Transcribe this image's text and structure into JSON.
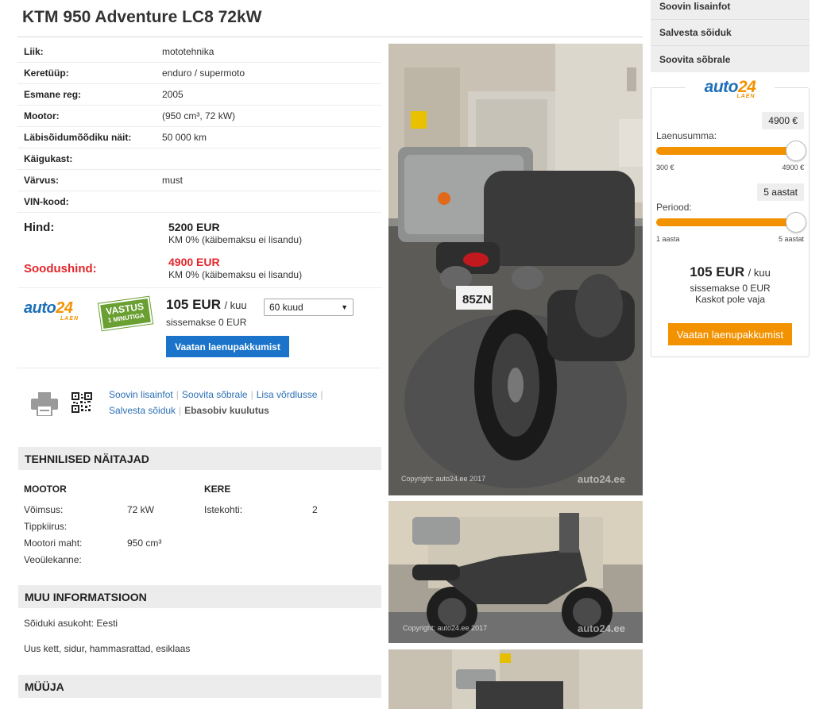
{
  "listing": {
    "title": "KTM 950 Adventure LC8 72kW",
    "specs": [
      {
        "label": "Liik:",
        "value": "mototehnika"
      },
      {
        "label": "Keretüüp:",
        "value": "enduro / supermoto"
      },
      {
        "label": "Esmane reg:",
        "value": "2005"
      },
      {
        "label": "Mootor:",
        "value": "(950 cm³, 72 kW)"
      },
      {
        "label": "Läbisõidumõõdiku näit:",
        "value": "50 000 km"
      },
      {
        "label": "Käigukast:",
        "value": ""
      },
      {
        "label": "Värvus:",
        "value": "must"
      },
      {
        "label": "VIN-kood:",
        "value": ""
      }
    ],
    "price": {
      "label": "Hind:",
      "value": "5200 EUR",
      "note": "KM 0% (käibemaksu ei lisandu)"
    },
    "sale_price": {
      "label": "Soodushind:",
      "value": "4900 EUR",
      "note": "KM 0% (käibemaksu ei lisandu)"
    }
  },
  "loan": {
    "logo_main": "auto",
    "logo_num": "24",
    "logo_sub": "LAEN",
    "badge_line1": "VASTUS",
    "badge_line2": "1 MINUTIGA",
    "monthly": "105 EUR",
    "monthly_unit": "/ kuu",
    "period_select": "60 kuud",
    "down_payment": "sissemakse 0 EUR",
    "button": "Vaatan laenupakkumist"
  },
  "actions": {
    "links": [
      "Soovin lisainfot",
      "Soovita sõbrale",
      "Lisa võrdlusse",
      "Salvesta sõiduk"
    ],
    "inactive": "Ebasobiv kuulutus",
    "print_icon": "printer-icon",
    "qr_icon": "qr-code-icon"
  },
  "technical": {
    "header": "TEHNILISED NÄITAJAD",
    "motor_title": "MOOTOR",
    "motor_items": [
      {
        "label": "Võimsus:",
        "value": "72 kW"
      },
      {
        "label": "Tippkiirus:",
        "value": ""
      },
      {
        "label": "Mootori maht:",
        "value": "950 cm³"
      },
      {
        "label": "Veoülekanne:",
        "value": ""
      }
    ],
    "body_title": "KERE",
    "body_items": [
      {
        "label": "Istekohti:",
        "value": "2"
      }
    ]
  },
  "other_info": {
    "header": "MUU INFORMATSIOON",
    "location": "Sõiduki asukoht: Eesti",
    "description": "Uus kett, sidur, hammasrattad, esiklaas"
  },
  "seller": {
    "header": "MÜÜJA"
  },
  "photos": {
    "copyright": "Copyright: auto24.ee 2017",
    "watermark": "auto24.ee",
    "plate": "85ZN"
  },
  "sidebar": {
    "menu": [
      "Soovin lisainfot",
      "Salvesta sõiduk",
      "Soovita sõbrale"
    ],
    "calc": {
      "amount_label": "Laenusumma:",
      "amount_value": "4900 €",
      "amount_min": "300 €",
      "amount_max": "4900 €",
      "amount_fraction": 1.0,
      "period_label": "Periood:",
      "period_value": "5 aastat",
      "period_min": "1 aasta",
      "period_max": "5 aastat",
      "period_fraction": 1.0,
      "monthly": "105 EUR",
      "monthly_unit": "/ kuu",
      "down_payment": "sissemakse 0 EUR",
      "kasko": "Kaskot pole vaja",
      "button": "Vaatan laenupakkumist"
    }
  },
  "colors": {
    "brand_blue": "#1c6fb8",
    "brand_orange": "#f39200",
    "sale_red": "#e3262b",
    "button_blue": "#1b74c9"
  }
}
